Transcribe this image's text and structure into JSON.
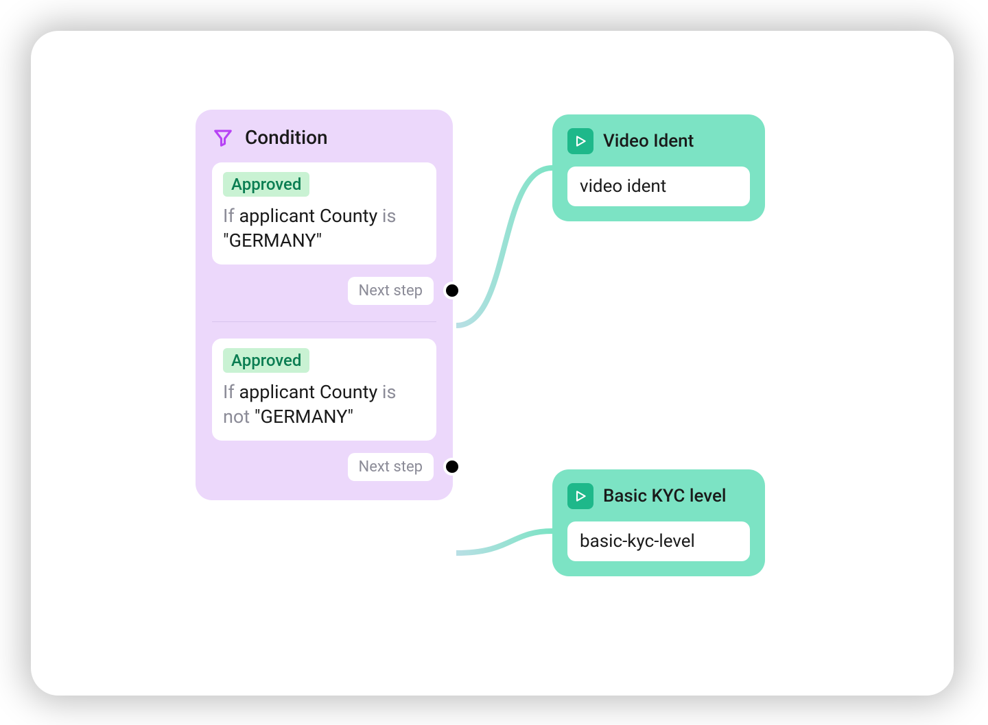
{
  "condition": {
    "title": "Condition",
    "rules": [
      {
        "status": "Approved",
        "if_kw": "If",
        "field": "applicant County",
        "op_kw": "is",
        "value": "\"GERMANY\"",
        "next_label": "Next step"
      },
      {
        "status": "Approved",
        "if_kw": "If",
        "field": "applicant County",
        "op_kw": "is not",
        "value": "\"GERMANY\"",
        "next_label": "Next step"
      }
    ]
  },
  "actions": {
    "video": {
      "title": "Video Ident",
      "value": "video ident"
    },
    "kyc": {
      "title": "Basic KYC level",
      "value": "basic-kyc-level"
    }
  },
  "colors": {
    "condition_bg": "#ecd8fb",
    "action_bg": "#7ce3c4",
    "accent_purple": "#b742f5",
    "accent_green": "#1eb88a",
    "badge_bg": "#c9f2d3",
    "badge_text": "#0a7d52"
  }
}
